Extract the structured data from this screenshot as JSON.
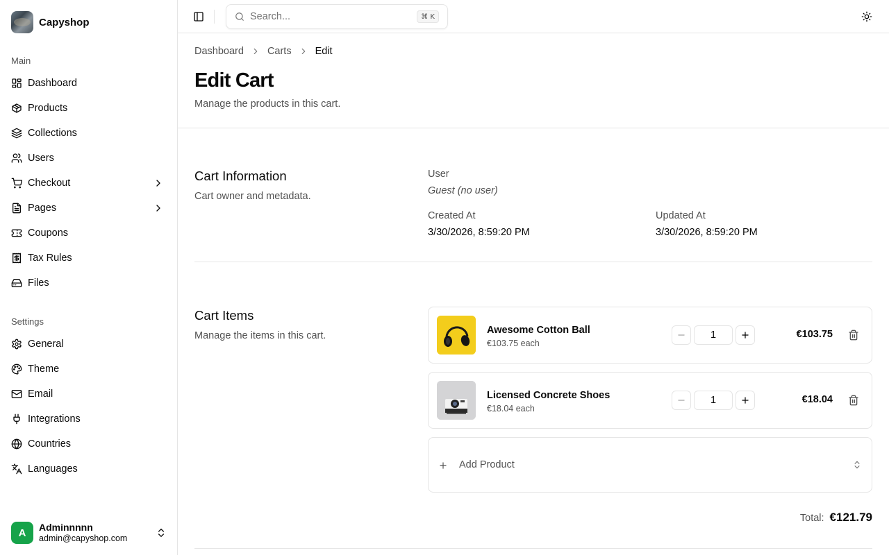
{
  "brand": {
    "name": "Capyshop"
  },
  "sidebar": {
    "main_label": "Main",
    "main_items": [
      {
        "label": "Dashboard",
        "icon": "dashboard-icon"
      },
      {
        "label": "Products",
        "icon": "package-icon"
      },
      {
        "label": "Collections",
        "icon": "layers-icon"
      },
      {
        "label": "Users",
        "icon": "users-icon"
      },
      {
        "label": "Checkout",
        "icon": "cart-icon",
        "expandable": true
      },
      {
        "label": "Pages",
        "icon": "file-text-icon",
        "expandable": true
      },
      {
        "label": "Coupons",
        "icon": "ticket-icon"
      },
      {
        "label": "Tax Rules",
        "icon": "receipt-icon"
      },
      {
        "label": "Files",
        "icon": "hard-drive-icon"
      }
    ],
    "settings_label": "Settings",
    "settings_items": [
      {
        "label": "General",
        "icon": "gear-icon"
      },
      {
        "label": "Theme",
        "icon": "palette-icon"
      },
      {
        "label": "Email",
        "icon": "mail-icon"
      },
      {
        "label": "Integrations",
        "icon": "plug-icon"
      },
      {
        "label": "Countries",
        "icon": "globe-icon"
      },
      {
        "label": "Languages",
        "icon": "translate-icon"
      }
    ],
    "user": {
      "initial": "A",
      "name": "Adminnnnn",
      "email": "admin@capyshop.com"
    }
  },
  "header": {
    "search_placeholder": "Search...",
    "search_shortcut": "⌘ K"
  },
  "breadcrumb": {
    "items": [
      "Dashboard",
      "Carts"
    ],
    "current": "Edit"
  },
  "page": {
    "title": "Edit Cart",
    "subtitle": "Manage the products in this cart."
  },
  "cart_info": {
    "title": "Cart Information",
    "subtitle": "Cart owner and metadata.",
    "user_label": "User",
    "user_value": "Guest (no user)",
    "created_label": "Created At",
    "created_value": "3/30/2026, 8:59:20 PM",
    "updated_label": "Updated At",
    "updated_value": "3/30/2026, 8:59:20 PM"
  },
  "cart_items": {
    "title": "Cart Items",
    "subtitle": "Manage the items in this cart.",
    "items": [
      {
        "name": "Awesome Cotton Ball",
        "each": "€103.75 each",
        "quantity": "1",
        "price": "€103.75",
        "thumb": "headphones"
      },
      {
        "name": "Licensed Concrete Shoes",
        "each": "€18.04 each",
        "quantity": "1",
        "price": "€18.04",
        "thumb": "camera"
      }
    ],
    "add_product_label": "Add Product",
    "total_label": "Total:",
    "total_value": "€121.79"
  }
}
